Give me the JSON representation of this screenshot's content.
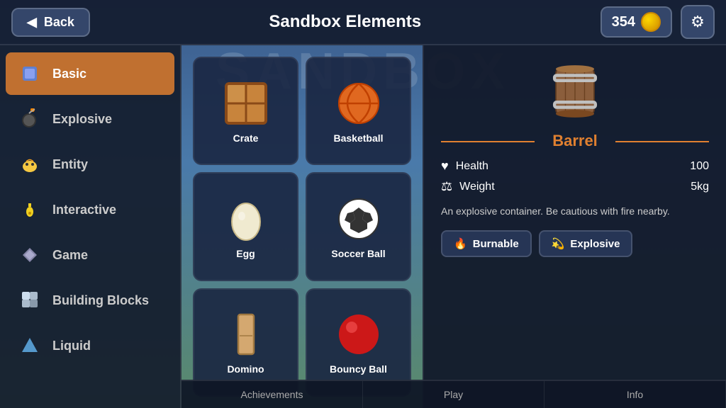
{
  "header": {
    "back_label": "Back",
    "title": "Sandbox Elements",
    "coins": "354",
    "settings_icon": "⚙"
  },
  "sidebar": {
    "items": [
      {
        "id": "basic",
        "label": "Basic",
        "icon": "🟦",
        "active": true
      },
      {
        "id": "explosive",
        "label": "Explosive",
        "icon": "💣",
        "active": false
      },
      {
        "id": "entity",
        "label": "Entity",
        "icon": "🐥",
        "active": false
      },
      {
        "id": "interactive",
        "label": "Interactive",
        "icon": "💡",
        "active": false
      },
      {
        "id": "game",
        "label": "Game",
        "icon": "🕹",
        "active": false
      },
      {
        "id": "building-blocks",
        "label": "Building Blocks",
        "icon": "🧊",
        "active": false
      },
      {
        "id": "liquid",
        "label": "Liquid",
        "icon": "🔺",
        "active": false
      }
    ]
  },
  "grid": {
    "items": [
      {
        "id": "crate",
        "label": "Crate"
      },
      {
        "id": "basketball",
        "label": "Basketball"
      },
      {
        "id": "egg",
        "label": "Egg"
      },
      {
        "id": "soccer-ball",
        "label": "Soccer Ball"
      },
      {
        "id": "domino",
        "label": "Domino"
      },
      {
        "id": "bouncy-ball",
        "label": "Bouncy Ball"
      }
    ]
  },
  "detail": {
    "title": "Barrel",
    "stats": [
      {
        "icon": "♥",
        "name": "Health",
        "value": "100"
      },
      {
        "icon": "⚖",
        "name": "Weight",
        "value": "5kg"
      }
    ],
    "description": "An explosive container. Be cautious with fire nearby.",
    "tags": [
      {
        "id": "burnable",
        "icon": "🔥",
        "label": "Burnable"
      },
      {
        "id": "explosive",
        "icon": "💫",
        "label": "Explosive"
      }
    ]
  },
  "bottom_tabs": [
    {
      "id": "achievements",
      "label": "Achievements"
    },
    {
      "id": "play",
      "label": "Play"
    },
    {
      "id": "info",
      "label": "Info"
    }
  ]
}
